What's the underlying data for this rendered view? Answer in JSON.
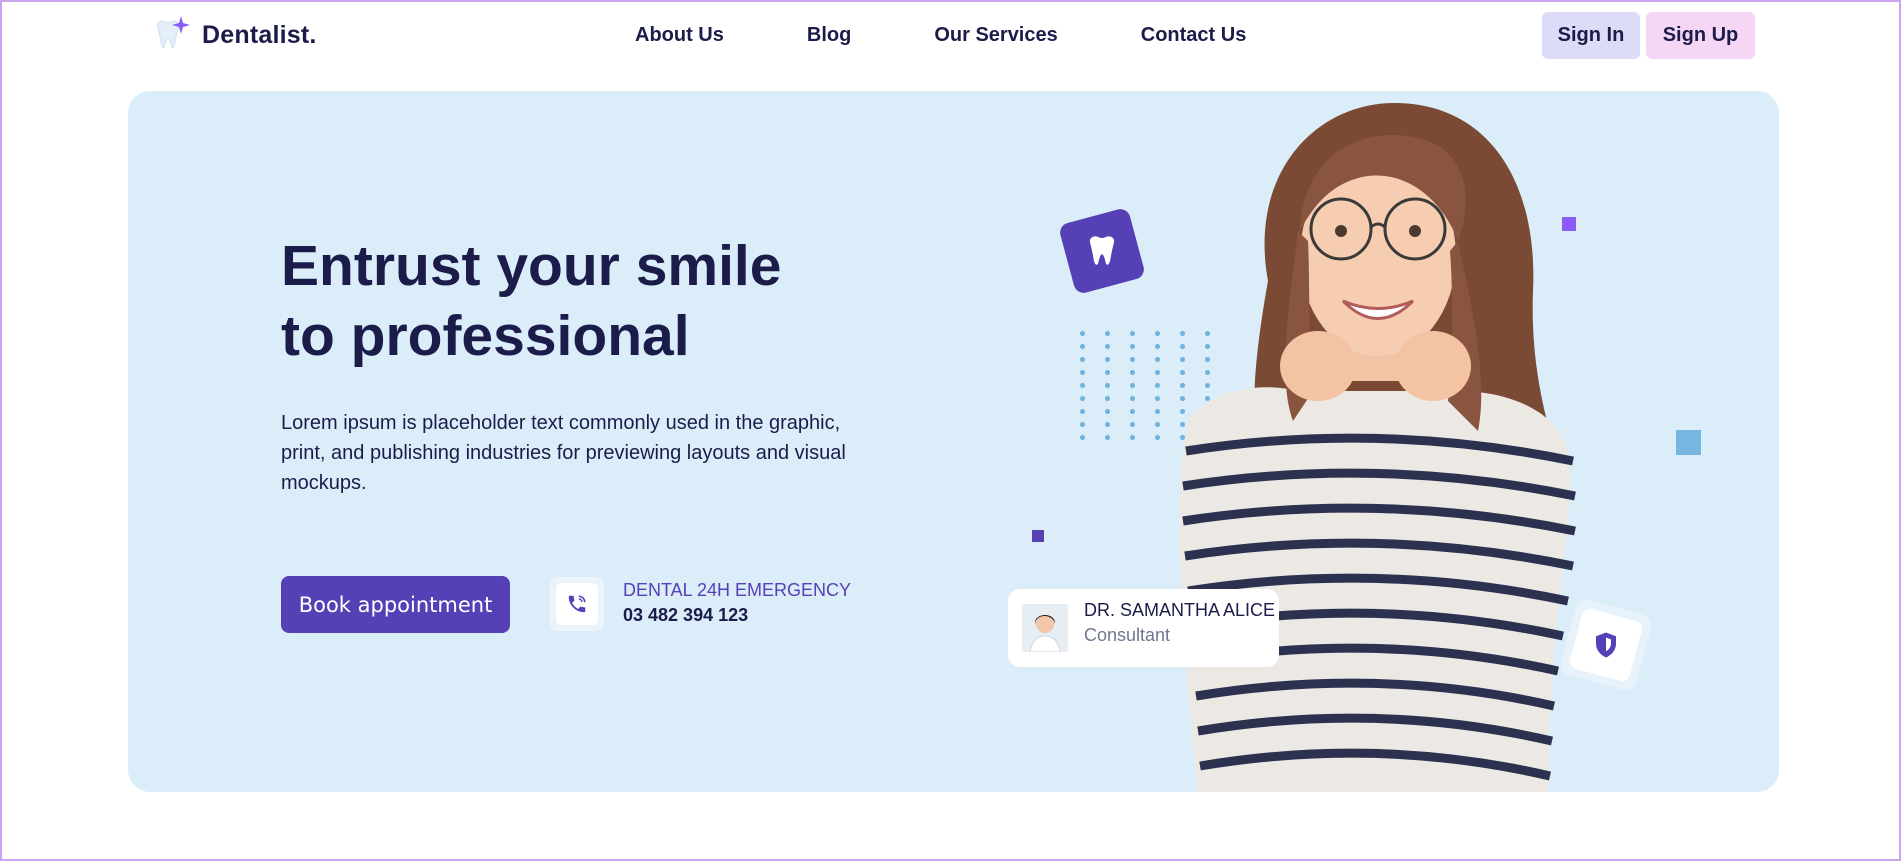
{
  "brand": {
    "name": "Dentalist."
  },
  "nav": {
    "links": [
      "About Us",
      "Blog",
      "Our Services",
      "Contact Us"
    ],
    "sign_in": "Sign In",
    "sign_up": "Sign Up"
  },
  "hero": {
    "headline_line1": "Entrust your smile",
    "headline_line2": "to professional",
    "description": "Lorem ipsum is placeholder text commonly used in the graphic, print, and publishing industries for previewing layouts and visual mockups.",
    "cta": "Book appointment",
    "emergency_label": "DENTAL 24H EMERGENCY",
    "emergency_phone": "03 482 394 123"
  },
  "doctor": {
    "name": "DR. SAMANTHA ALICE",
    "role": "Consultant"
  },
  "colors": {
    "primary": "#5640b6",
    "hero_bg": "#dbedf9",
    "text_dark": "#1c1c4a",
    "sign_in_bg": "#dcdcf8",
    "sign_up_bg": "#f5d7f5"
  },
  "icons": [
    "tooth-sparkle-logo-icon",
    "phone-icon",
    "tooth-icon",
    "shield-icon"
  ]
}
